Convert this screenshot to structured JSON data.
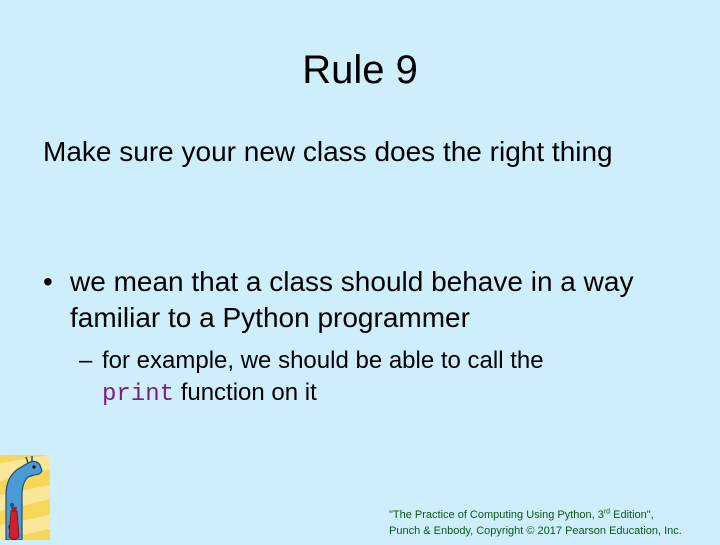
{
  "slide": {
    "title": "Rule 9",
    "intro": "Make sure your new class does the right thing",
    "bullet": {
      "marker": "•",
      "text": "we mean that a class should behave in a way familiar to a Python programmer"
    },
    "sub_bullet": {
      "marker": "–",
      "text_before": "for example, we should be able to call the",
      "code": "print",
      "text_after": "function on it"
    }
  },
  "footer": {
    "line1_start": "\"The Practice of Computing Using Python, 3",
    "line1_sup": "rd",
    "line1_end": " Edition\",",
    "line2": "Punch & Enbody, Copyright © 2017 Pearson Education, Inc."
  },
  "colors": {
    "background": "#cfeefc",
    "code": "#7a1f7a",
    "footer": "#0a5a14"
  },
  "logo": {
    "icon": "giraffe-logo-icon"
  }
}
